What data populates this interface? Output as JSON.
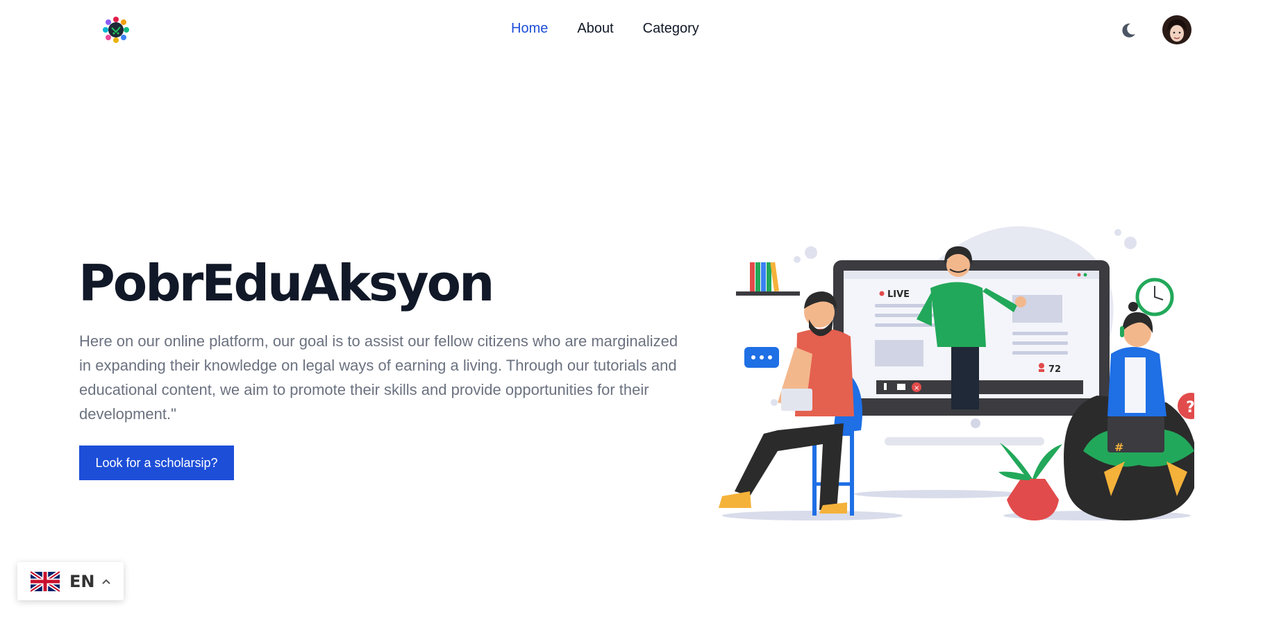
{
  "header": {
    "logo_icon": "colorful-people-circle-logo-icon",
    "nav": [
      {
        "label": "Home",
        "active": true
      },
      {
        "label": "About",
        "active": false
      },
      {
        "label": "Category",
        "active": false
      }
    ],
    "theme_toggle_icon": "moon-icon",
    "avatar_icon": "user-avatar"
  },
  "hero": {
    "title": "PobrEduAksyon",
    "description": "Here on our online platform, our goal is to assist our fellow citizens who are marginalized in expanding their knowledge on legal ways of earning a living. Through our tutorials and educational content, we aim to promote their skills and provide opportunities for their development.\"",
    "cta_label": "Look for a scholarsip?"
  },
  "illustration": {
    "live_label": "LIVE",
    "viewer_count": "72",
    "hash_symbol": "#",
    "question_mark": "?"
  },
  "language": {
    "code": "EN",
    "flag_icon": "uk-flag-icon",
    "chevron_icon": "chevron-up-icon"
  },
  "colors": {
    "accent": "#1d4ed8",
    "title": "#111827",
    "body_text": "#6b7280",
    "green": "#22a85a",
    "red_shirt": "#e4604f",
    "blue_hoodie": "#1f6fe5",
    "shoe_yellow": "#f5b23a"
  }
}
